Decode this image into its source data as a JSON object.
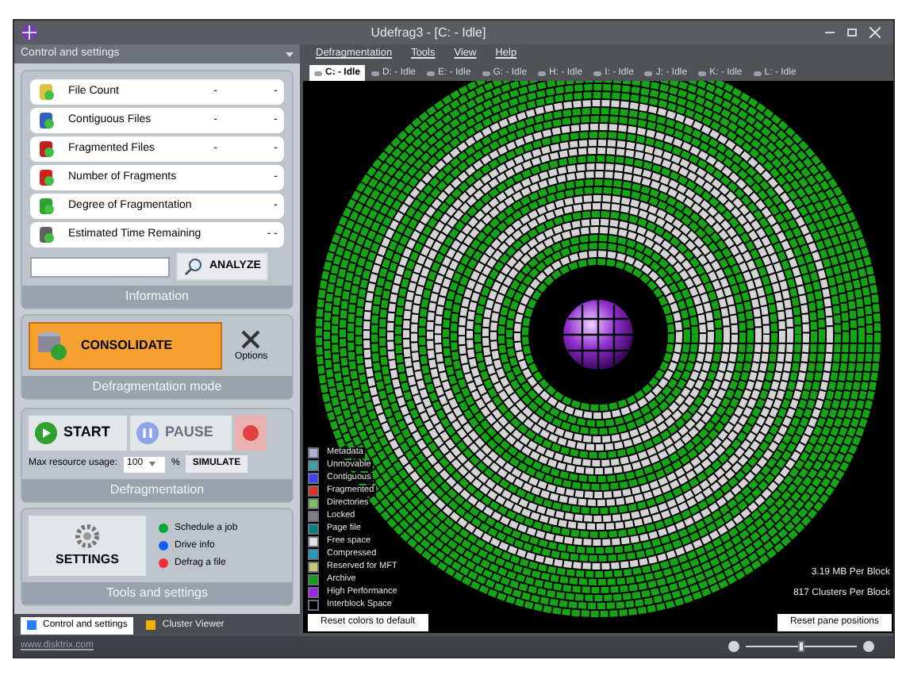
{
  "window": {
    "title": "Udefrag3 - [C: - Idle]"
  },
  "left_panel": {
    "title": "Control and settings",
    "stats": [
      {
        "label": "File Count",
        "values": [
          "-",
          "-"
        ]
      },
      {
        "label": "Contiguous Files",
        "values": [
          "-",
          "-"
        ]
      },
      {
        "label": "Fragmented Files",
        "values": [
          "-",
          "-"
        ]
      },
      {
        "label": "Number of Fragments",
        "values": [
          "-"
        ]
      },
      {
        "label": "Degree of Fragmentation",
        "values": [
          "-"
        ]
      },
      {
        "label": "Estimated Time Remaining",
        "values": [
          "- -"
        ]
      }
    ],
    "analyze_button": "ANALYZE",
    "information_caption": "Information",
    "mode_button": "CONSOLIDATE",
    "options_button": "Options",
    "mode_caption": "Defragmentation mode",
    "start_button": "START",
    "pause_button": "PAUSE",
    "resource_label": "Max resource usage:",
    "resource_value": "100",
    "resource_unit": "%",
    "simulate_button": "SIMULATE",
    "defrag_caption": "Defragmentation",
    "settings_button": "SETTINGS",
    "links": [
      "Schedule a job",
      "Drive info",
      "Defrag a file"
    ],
    "tools_caption": "Tools and settings"
  },
  "bottom_tabs": [
    {
      "label": "Control and settings",
      "selected": true
    },
    {
      "label": "Cluster Viewer",
      "selected": false
    }
  ],
  "status_bar": "www.disktrix.com",
  "menu": [
    "Defragmentation",
    "Tools",
    "View",
    "Help"
  ],
  "drive_tabs": [
    {
      "label": "C: - Idle",
      "selected": true
    },
    {
      "label": "D: - Idle",
      "selected": false
    },
    {
      "label": "E: - Idle",
      "selected": false
    },
    {
      "label": "G: - Idle",
      "selected": false
    },
    {
      "label": "H: - Idle",
      "selected": false
    },
    {
      "label": "I: - Idle",
      "selected": false
    },
    {
      "label": "J: - Idle",
      "selected": false
    },
    {
      "label": "K: - Idle",
      "selected": false
    },
    {
      "label": "L: - Idle",
      "selected": false
    }
  ],
  "legend": [
    {
      "label": "Metadata",
      "color": "#b0b0d0"
    },
    {
      "label": "Unmovable",
      "color": "#40a0a0"
    },
    {
      "label": "Contiguous",
      "color": "#4040ff"
    },
    {
      "label": "Fragmented",
      "color": "#e03020"
    },
    {
      "label": "Directories",
      "color": "#80c060"
    },
    {
      "label": "Locked",
      "color": "#808080"
    },
    {
      "label": "Page file",
      "color": "#008080"
    },
    {
      "label": "Free space",
      "color": "#e0e0e0"
    },
    {
      "label": "Compressed",
      "color": "#20a0c0"
    },
    {
      "label": "Reserved for MFT",
      "color": "#c8c870"
    },
    {
      "label": "Archive",
      "color": "#10a010"
    },
    {
      "label": "High Performance",
      "color": "#a020f0"
    },
    {
      "label": "Interblock Space",
      "color": "#000000"
    }
  ],
  "block_info": [
    "3.19 MB Per Block",
    "817 Clusters Per Block"
  ],
  "reset_colors_button": "Reset colors to default",
  "reset_panes_button": "Reset pane positions",
  "zoom": {
    "level": 0.5
  }
}
